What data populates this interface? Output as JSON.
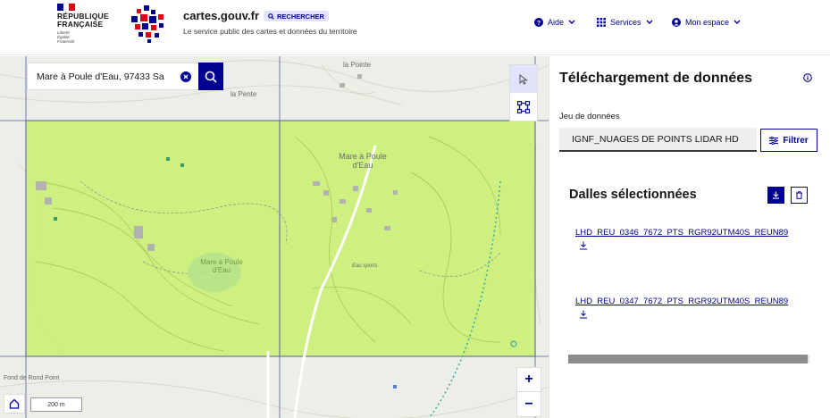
{
  "header": {
    "republic_line1": "RÉPUBLIQUE",
    "republic_line2": "FRANÇAISE",
    "motto_line1": "Liberté",
    "motto_line2": "Égalité",
    "motto_line3": "Fraternité",
    "site_title": "cartes.gouv.fr",
    "search_badge": "RECHERCHER",
    "subtitle": "Le service public des cartes et données du territoire",
    "nav": [
      {
        "label": "Aide",
        "icon": "help-circle-icon"
      },
      {
        "label": "Services",
        "icon": "grid-icon"
      },
      {
        "label": "Mon espace",
        "icon": "account-icon"
      }
    ]
  },
  "map": {
    "search_value": "Mare à Poule d'Eau, 97433 Sa",
    "labels": {
      "la_pointe": "la Pointe",
      "la_pente": "la Pente",
      "mare_poule_1": "Mare à Poule",
      "mare_poule_2": "d'Eau",
      "mare_poule_small_1": "Mare à Poule",
      "mare_poule_small_2": "d'Eau",
      "eau_sports": "Eau sports"
    },
    "attribution": "Fond de Rond Point",
    "scale_label": "200 m",
    "zoom_in": "+",
    "zoom_out": "−"
  },
  "panel": {
    "title": "Téléchargement de données",
    "dataset_label": "Jeu de données",
    "dataset_value": "IGNF_NUAGES DE POINTS LIDAR HD",
    "filter_label": "Filtrer",
    "selected_title": "Dalles sélectionnées",
    "tiles": [
      "LHD_REU_0346_7672_PTS_RGR92UTM40S_REUN89",
      "LHD_REU_0347_7672_PTS_RGR92UTM40S_REUN89"
    ]
  },
  "colors": {
    "primary": "#000091",
    "tile_fill": "#c8f06e",
    "tile_border": "#5a5aa0"
  }
}
